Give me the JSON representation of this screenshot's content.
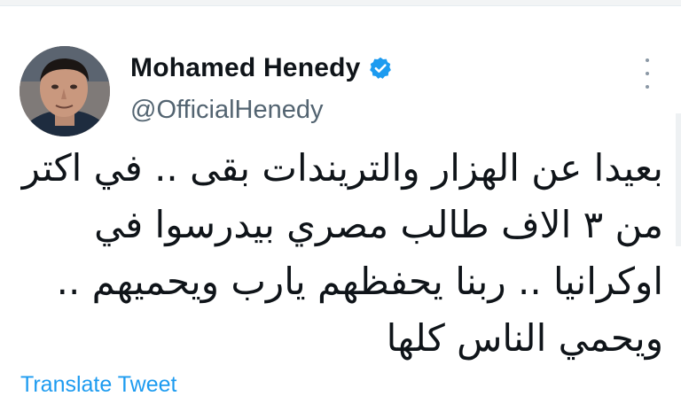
{
  "tweet": {
    "author": {
      "display_name": "Mohamed Henedy",
      "handle": "@OfficialHenedy",
      "verified": true
    },
    "text_lines": [
      "بعيدا عن الهزار والتريندات بقى .. في اكتر",
      "من ٣ الاف طالب مصري بيدرسوا في",
      "اوكرانيا .. ربنا يحفظهم يارب ويحميهم ..",
      "ويحمي الناس كلها"
    ],
    "translate_label": "Translate Tweet",
    "menu_icon": "more-horizontal-icon"
  },
  "colors": {
    "text_primary": "#0f1419",
    "text_secondary": "#536471",
    "accent": "#1d9bf0",
    "verified_badge": "#1d9bf0"
  }
}
